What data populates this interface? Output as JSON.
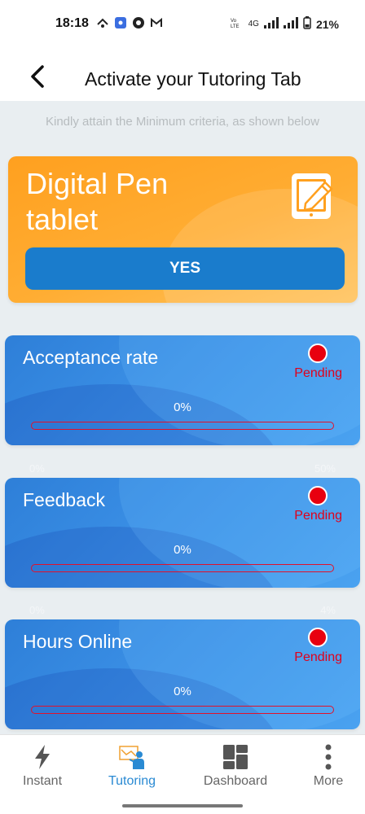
{
  "status_bar": {
    "time": "18:18",
    "network": "4G",
    "battery": "21%"
  },
  "app_bar": {
    "title": "Activate your Tutoring Tab",
    "back_icon": "chevron-left-icon"
  },
  "hint": "Kindly attain the Minimum criteria, as shown below",
  "pen_card": {
    "title": "Digital Pen tablet",
    "icon": "tablet-pen-icon",
    "button_label": "YES",
    "color": "#ffa01f",
    "button_color": "#1a7ccc"
  },
  "metrics": [
    {
      "title": "Acceptance rate",
      "status": "Pending",
      "value_label": "0%",
      "progress": 0,
      "min_label": "0%",
      "max_label": "50%"
    },
    {
      "title": "Feedback",
      "status": "Pending",
      "value_label": "0%",
      "progress": 0,
      "min_label": "0%",
      "max_label": "4%"
    },
    {
      "title": "Hours Online",
      "status": "Pending",
      "value_label": "0%",
      "progress": 0
    }
  ],
  "status_color": "#e0001b",
  "bottom_nav": {
    "active": "Tutoring",
    "accent": "#2a8ad3",
    "items": [
      {
        "label": "Instant",
        "icon": "lightning-icon"
      },
      {
        "label": "Tutoring",
        "icon": "teacher-icon"
      },
      {
        "label": "Dashboard",
        "icon": "dashboard-icon"
      },
      {
        "label": "More",
        "icon": "more-vertical-icon"
      }
    ]
  }
}
